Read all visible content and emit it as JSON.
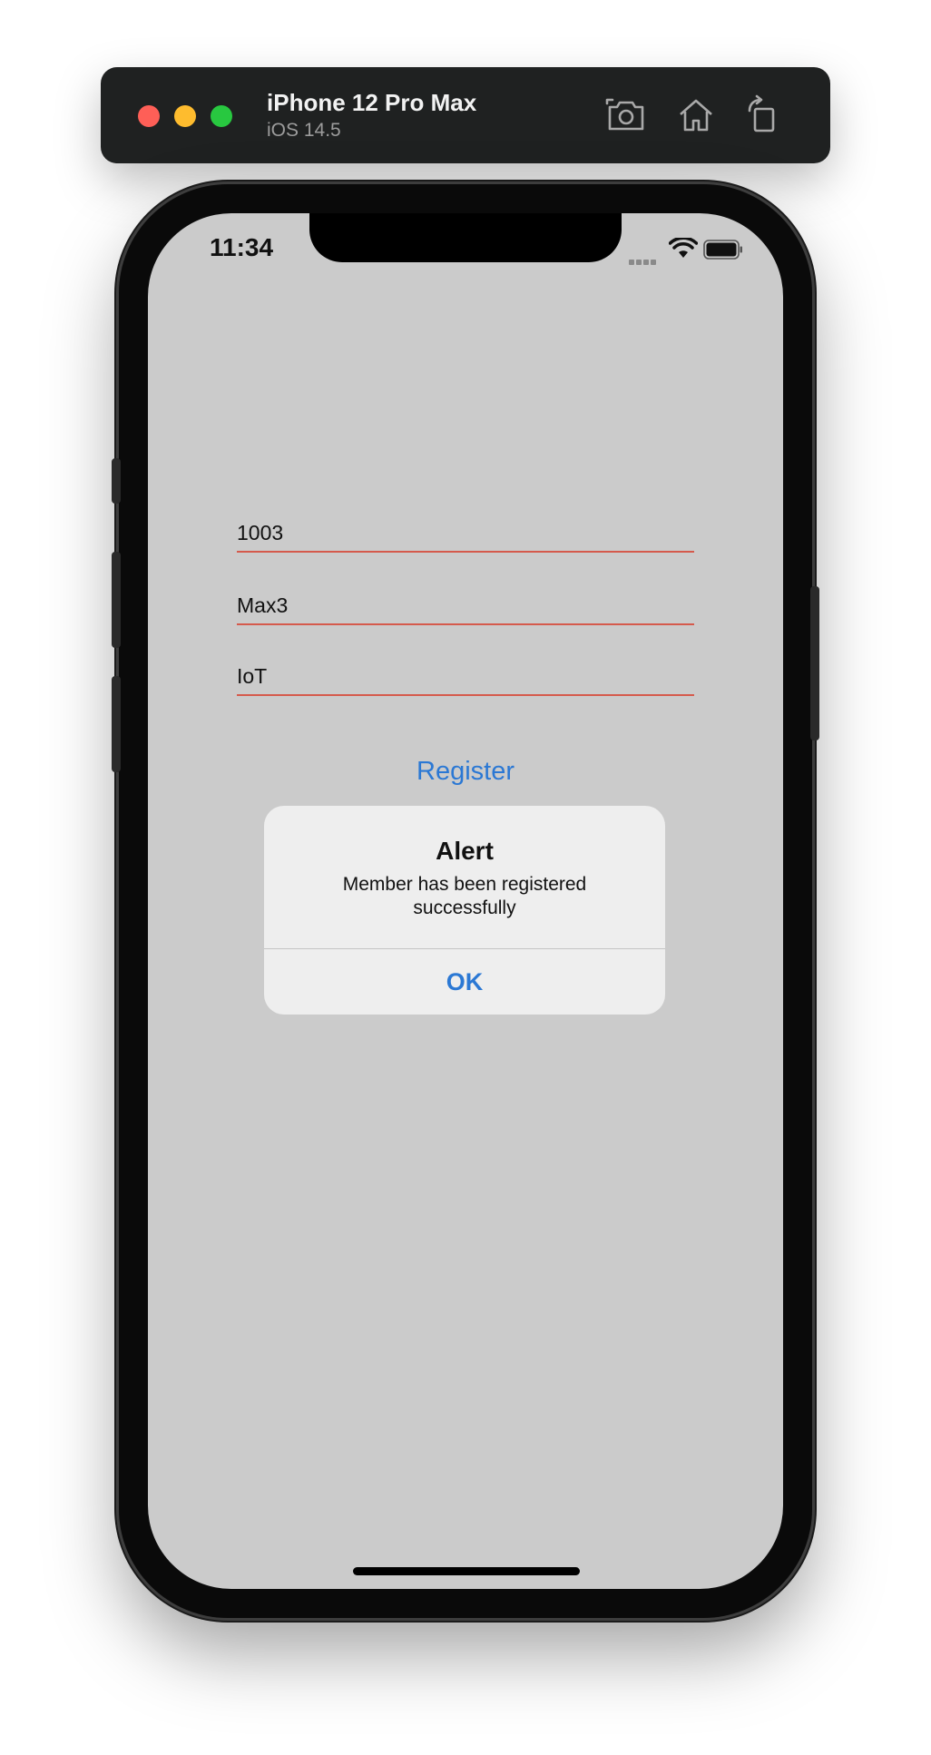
{
  "toolbar": {
    "device_name": "iPhone 12 Pro Max",
    "os_version": "iOS 14.5",
    "icons": [
      "screenshot-icon",
      "home-icon",
      "rotate-icon"
    ]
  },
  "status_bar": {
    "time": "11:34"
  },
  "form": {
    "field1_value": "1003",
    "field2_value": "Max3",
    "field3_value": "IoT",
    "register_label": "Register"
  },
  "alert": {
    "title": "Alert",
    "message": "Member has been registered successfully",
    "ok_label": "OK"
  },
  "colors": {
    "accent": "#2b78d4",
    "field_underline": "#d55a4c",
    "screen_background": "#cbcbcb",
    "toolbar_background": "#1f2121"
  }
}
